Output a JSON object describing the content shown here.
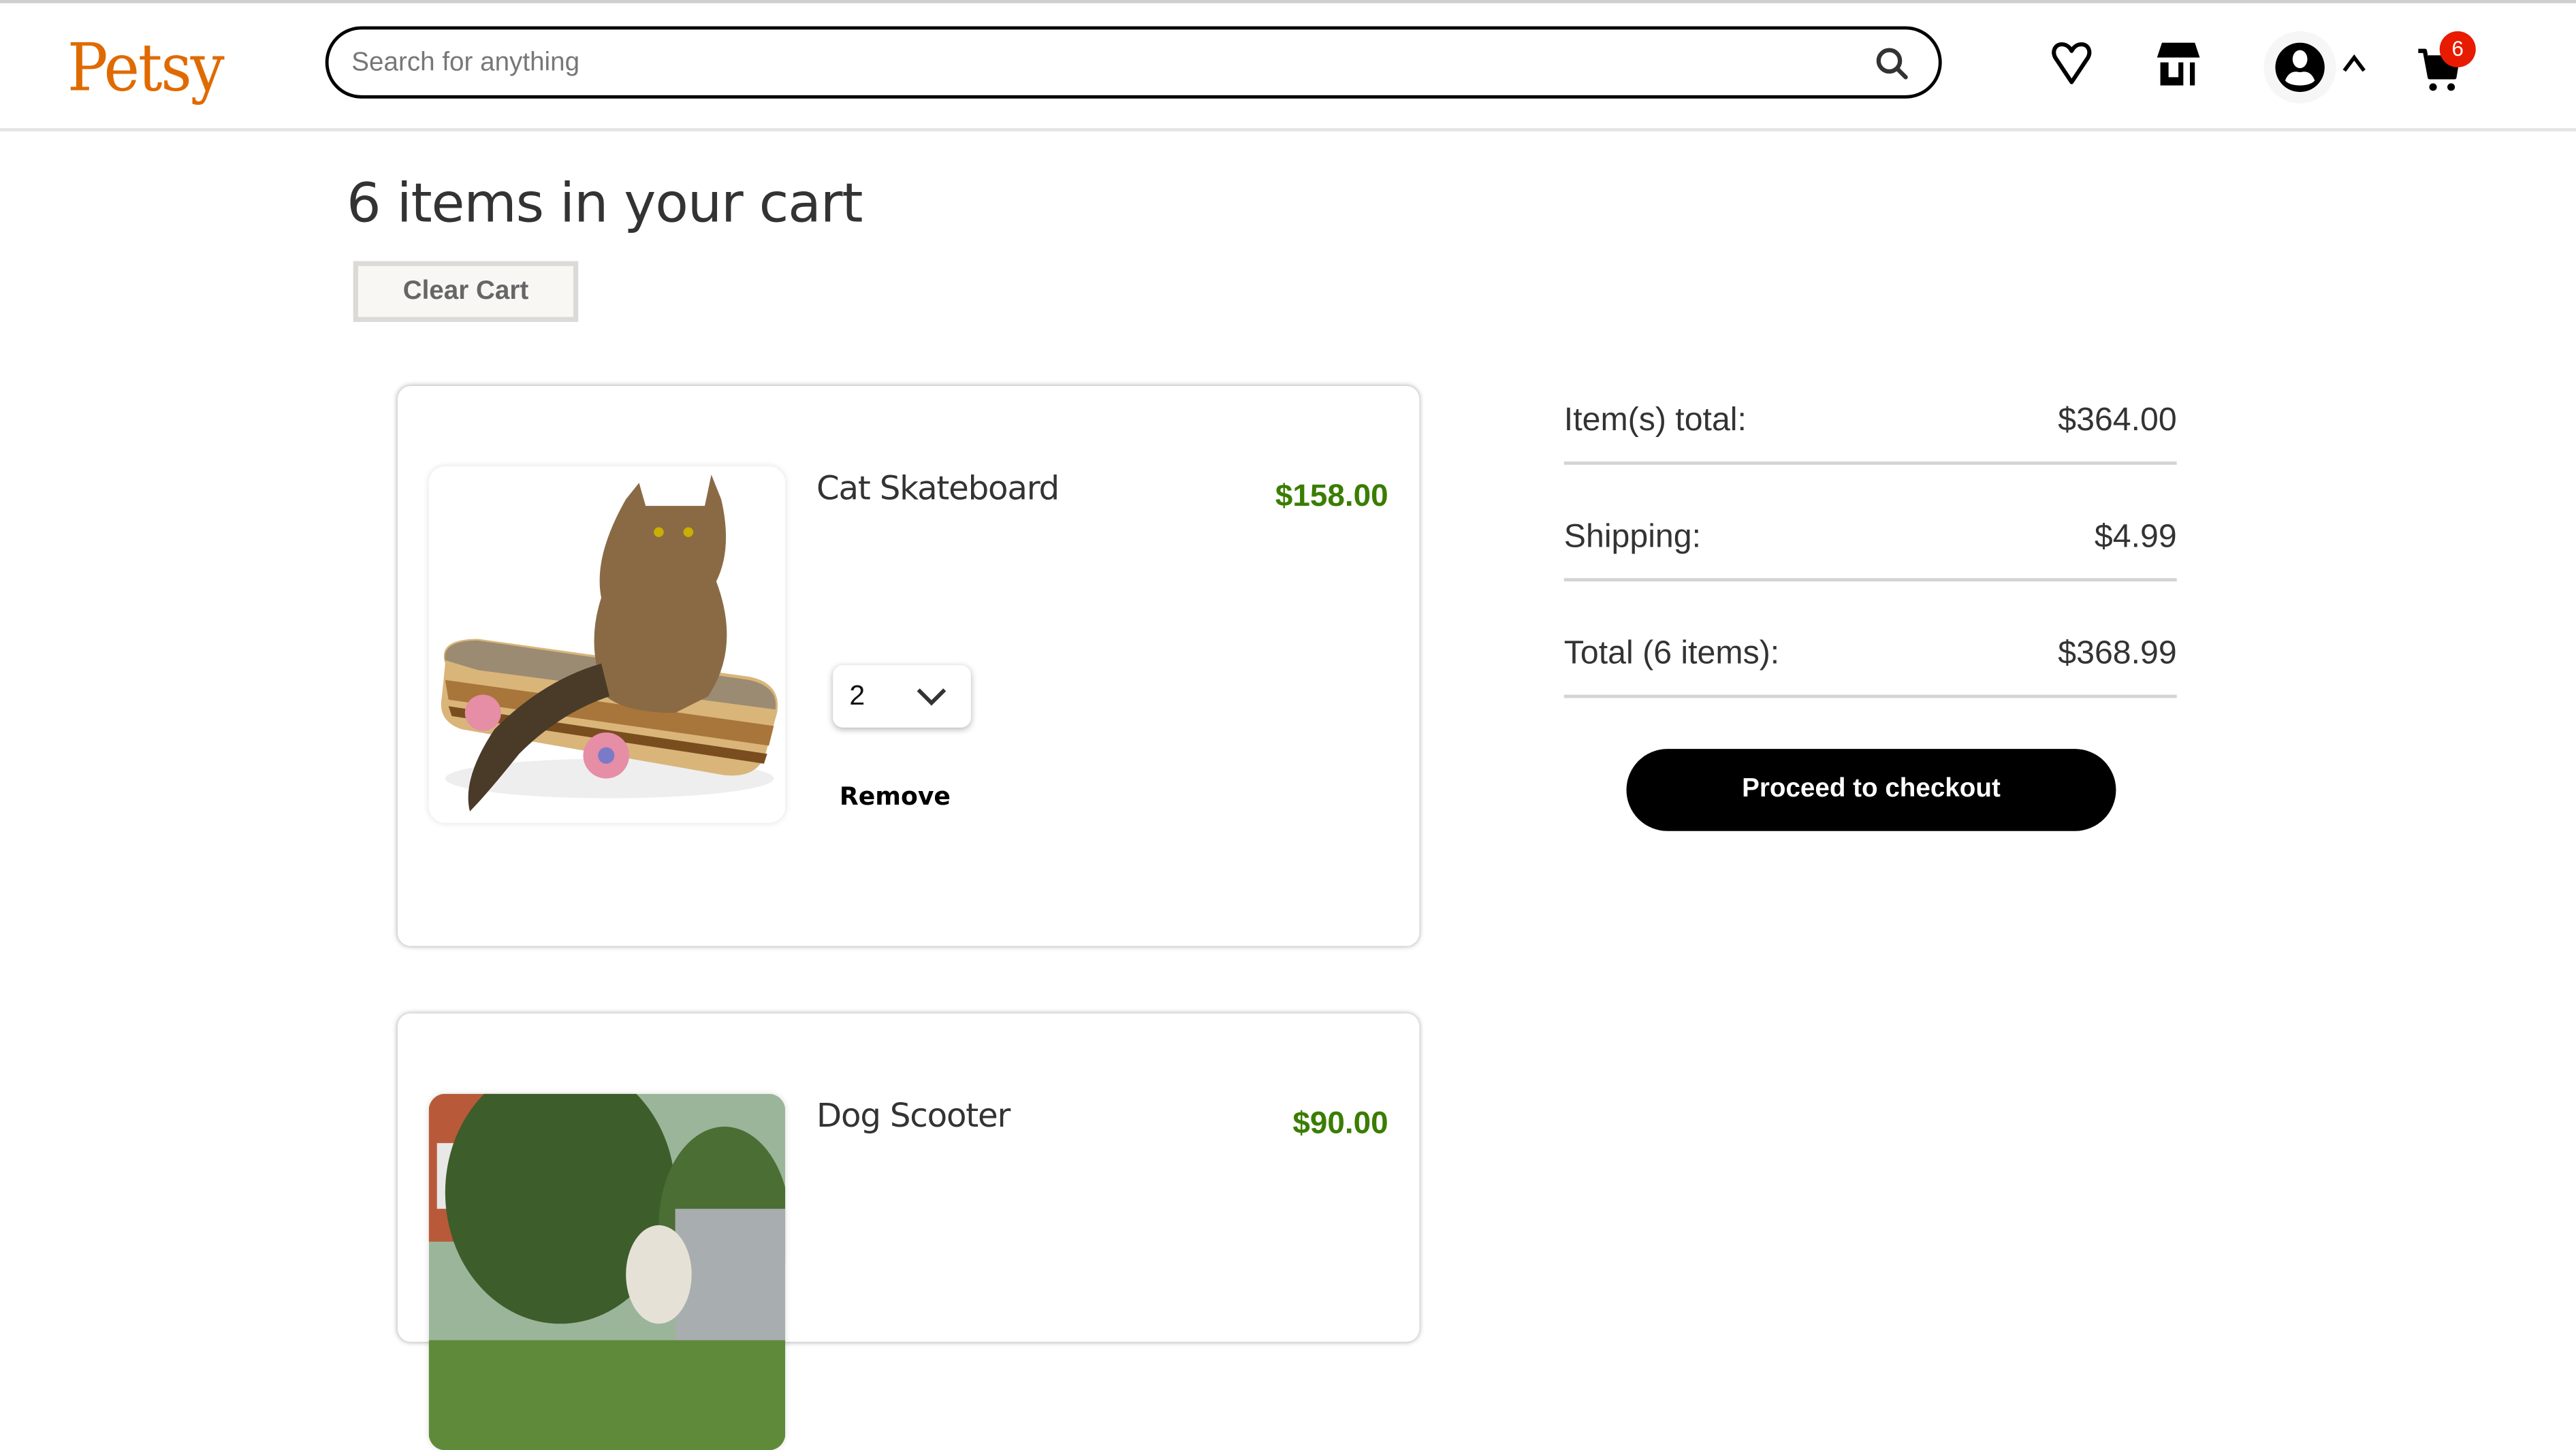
{
  "header": {
    "logo": "Petsy",
    "search_placeholder": "Search for anything",
    "search_value": "",
    "cart_count": "6",
    "colors": {
      "brand": "#e06a00",
      "badge": "#e81b00"
    }
  },
  "cart": {
    "title": "6 items in your cart",
    "clear_label": "Clear Cart",
    "items": [
      {
        "name": "Cat Skateboard",
        "price": "$158.00",
        "quantity": "2",
        "remove_label": "Remove"
      },
      {
        "name": "Dog Scooter",
        "price": "$90.00"
      }
    ],
    "price_color": "#3a7d00"
  },
  "summary": {
    "rows": [
      {
        "label": "Item(s) total:",
        "value": "$364.00"
      },
      {
        "label": "Shipping:",
        "value": "$4.99"
      },
      {
        "label": "Total (6 items):",
        "value": "$368.99"
      }
    ],
    "checkout_label": "Proceed to checkout"
  }
}
